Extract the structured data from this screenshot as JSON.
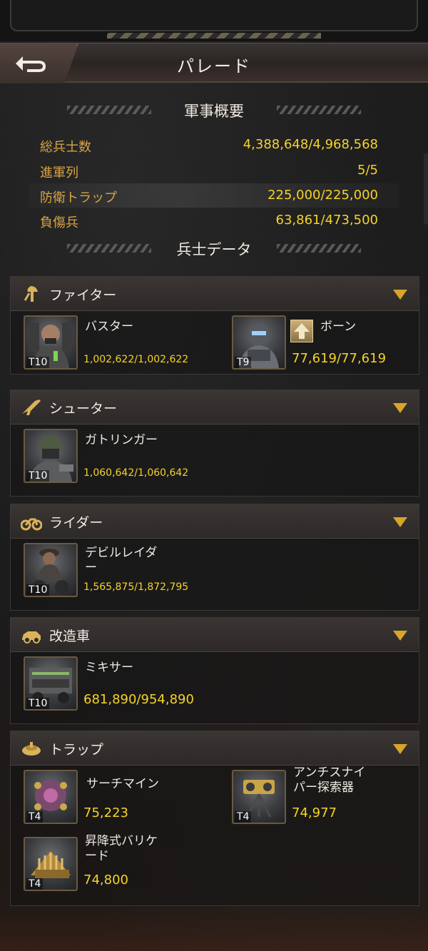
{
  "header": {
    "title": "パレード"
  },
  "summary": {
    "title": "軍事概要",
    "rows": [
      {
        "label": "総兵士数",
        "value": "4,388,648/4,968,568"
      },
      {
        "label": "進軍列",
        "value": "5/5"
      },
      {
        "label": "防衛トラップ",
        "value": "225,000/225,000"
      },
      {
        "label": "負傷兵",
        "value": "63,861/473,500"
      }
    ]
  },
  "soldier_data": {
    "title": "兵士データ"
  },
  "categories": [
    {
      "label": "ファイター",
      "units": [
        {
          "name": "バスター",
          "tier": "T10",
          "count": "1,002,622/1,002,622"
        },
        {
          "name": "ボーン",
          "tier": "T9",
          "count": "77,619/77,619"
        }
      ]
    },
    {
      "label": "シューター",
      "units": [
        {
          "name": "ガトリンガー",
          "tier": "T10",
          "count": "1,060,642/1,060,642"
        }
      ]
    },
    {
      "label": "ライダー",
      "units": [
        {
          "name": "デビルレイダ\nー",
          "tier": "T10",
          "count": "1,565,875/1,872,795"
        }
      ]
    },
    {
      "label": "改造車",
      "units": [
        {
          "name": "ミキサー",
          "tier": "T10",
          "count": "681,890/954,890"
        }
      ]
    },
    {
      "label": "トラップ",
      "units": [
        {
          "name": "サーチマイン",
          "tier": "T4",
          "count": "75,223"
        },
        {
          "name": "アンチスナイ\nパー探索器",
          "tier": "T4",
          "count": "74,977"
        },
        {
          "name": "昇降式バリケ\nード",
          "tier": "T4",
          "count": "74,800"
        }
      ]
    }
  ],
  "colors": {
    "label_gold": "#d9a441",
    "value_yellow": "#f5d32a",
    "chevron": "#d7a52a"
  }
}
